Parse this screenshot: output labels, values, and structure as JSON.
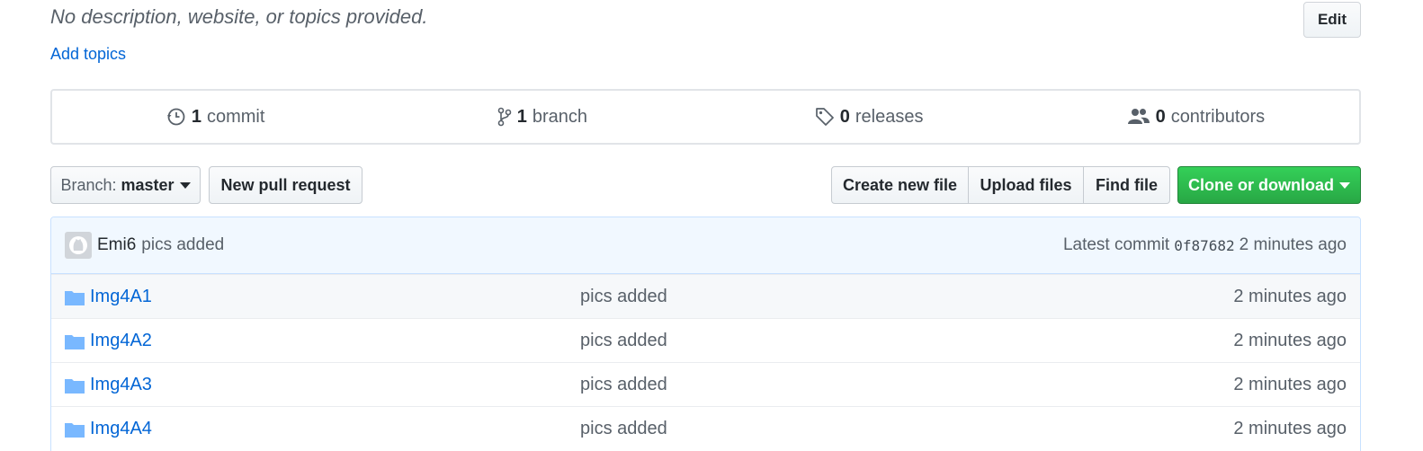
{
  "description": "No description, website, or topics provided.",
  "add_topics": "Add topics",
  "edit_label": "Edit",
  "summary": {
    "commits": {
      "num": "1",
      "label": "commit",
      "icon": "history-icon"
    },
    "branches": {
      "num": "1",
      "label": "branch",
      "icon": "branch-icon"
    },
    "releases": {
      "num": "0",
      "label": "releases",
      "icon": "tag-icon"
    },
    "contributors": {
      "num": "0",
      "label": "contributors",
      "icon": "people-icon"
    }
  },
  "toolbar": {
    "branch_prefix": "Branch:",
    "branch_name": "master",
    "new_pull_request": "New pull request",
    "create_new_file": "Create new file",
    "upload_files": "Upload files",
    "find_file": "Find file",
    "clone_or_download": "Clone or download"
  },
  "commit_tease": {
    "author": "Emi6",
    "message": "pics added",
    "latest_prefix": "Latest commit",
    "sha": "0f87682",
    "age": "2 minutes ago"
  },
  "files": [
    {
      "name": "Img4A1",
      "message": "pics added",
      "age": "2 minutes ago"
    },
    {
      "name": "Img4A2",
      "message": "pics added",
      "age": "2 minutes ago"
    },
    {
      "name": "Img4A3",
      "message": "pics added",
      "age": "2 minutes ago"
    },
    {
      "name": "Img4A4",
      "message": "pics added",
      "age": "2 minutes ago"
    }
  ],
  "colors": {
    "link": "#0366d6",
    "clone_green": "#28a745",
    "commit_bar": "#f1f8ff",
    "folder": "#79b8ff"
  }
}
